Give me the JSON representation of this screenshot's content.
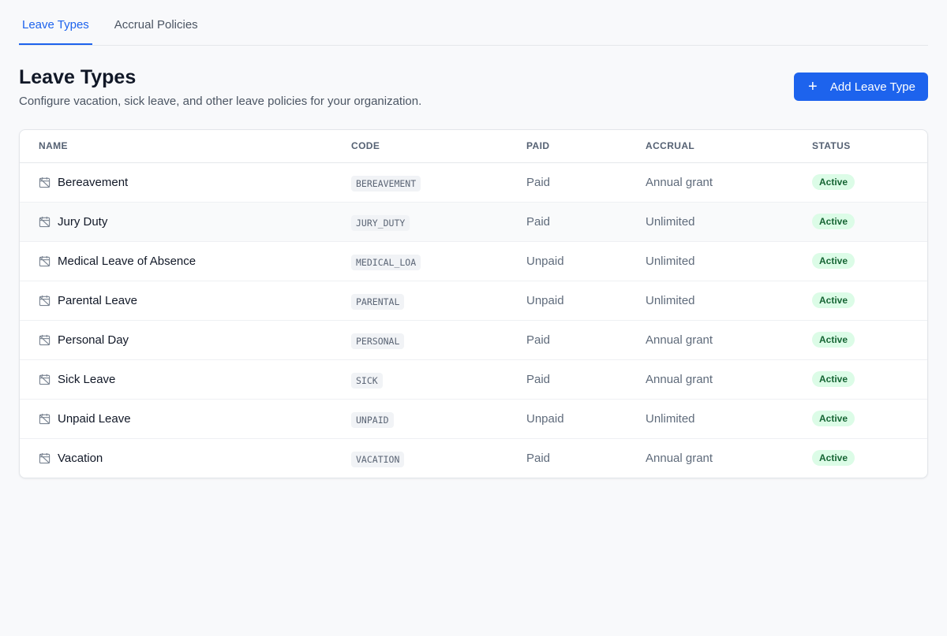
{
  "tabs": [
    {
      "label": "Leave Types",
      "active": true
    },
    {
      "label": "Accrual Policies",
      "active": false
    }
  ],
  "header": {
    "title": "Leave Types",
    "subtitle": "Configure vacation, sick leave, and other leave policies for your organization.",
    "add_button_label": "Add Leave Type",
    "add_button_icon": "plus-icon"
  },
  "table": {
    "columns": [
      "NAME",
      "CODE",
      "PAID",
      "ACCRUAL",
      "STATUS"
    ],
    "row_icon": "calendar-off-icon",
    "rows": [
      {
        "name": "Bereavement",
        "code": "BEREAVEMENT",
        "paid": "Paid",
        "accrual": "Annual grant",
        "status": "Active"
      },
      {
        "name": "Jury Duty",
        "code": "JURY_DUTY",
        "paid": "Paid",
        "accrual": "Unlimited",
        "status": "Active"
      },
      {
        "name": "Medical Leave of Absence",
        "code": "MEDICAL_LOA",
        "paid": "Unpaid",
        "accrual": "Unlimited",
        "status": "Active"
      },
      {
        "name": "Parental Leave",
        "code": "PARENTAL",
        "paid": "Unpaid",
        "accrual": "Unlimited",
        "status": "Active"
      },
      {
        "name": "Personal Day",
        "code": "PERSONAL",
        "paid": "Paid",
        "accrual": "Annual grant",
        "status": "Active"
      },
      {
        "name": "Sick Leave",
        "code": "SICK",
        "paid": "Paid",
        "accrual": "Annual grant",
        "status": "Active"
      },
      {
        "name": "Unpaid Leave",
        "code": "UNPAID",
        "paid": "Unpaid",
        "accrual": "Unlimited",
        "status": "Active"
      },
      {
        "name": "Vacation",
        "code": "VACATION",
        "paid": "Paid",
        "accrual": "Annual grant",
        "status": "Active"
      }
    ]
  },
  "colors": {
    "accent": "#1d63ed",
    "status_active_bg": "#dcfce7",
    "status_active_text": "#166534"
  }
}
